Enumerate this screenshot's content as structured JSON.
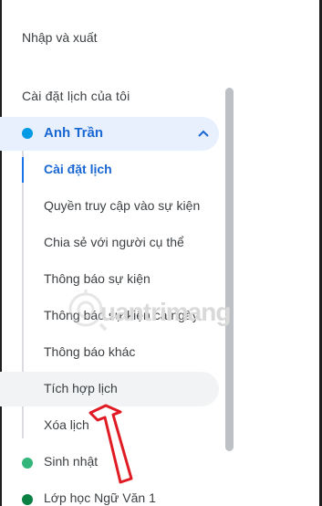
{
  "menu": {
    "import_export": "Nhập và xuất",
    "section_title": "Cài đặt lịch của tôi"
  },
  "calendars": {
    "primary": {
      "name": "Anh Trần",
      "color": "#039be5",
      "sub_items": [
        "Cài đặt lịch",
        "Quyền truy cập vào sự kiện",
        "Chia sẻ với người cụ thể",
        "Thông báo sự kiện",
        "Thông báo sự kiện cả ngày",
        "Thông báo khác",
        "Tích hợp lịch",
        "Xóa lịch"
      ],
      "active_item": "Cài đặt lịch",
      "hovered_item": "Tích hợp lịch"
    },
    "others": [
      {
        "name": "Sinh nhật",
        "color": "#33b679"
      },
      {
        "name": "Lớp học Ngữ Văn 1",
        "color": "#0b8043"
      }
    ]
  },
  "icons": {
    "collapse": "chevron-up-icon",
    "annotation": "red-arrow-icon",
    "watermark": "quantrimang-logo"
  },
  "colors": {
    "accent": "#1967d2",
    "selected_bg": "#e8f0fe",
    "hover_bg": "#f1f3f4",
    "annotation_arrow": "#e01b24"
  },
  "watermark_text": "uantrimang"
}
